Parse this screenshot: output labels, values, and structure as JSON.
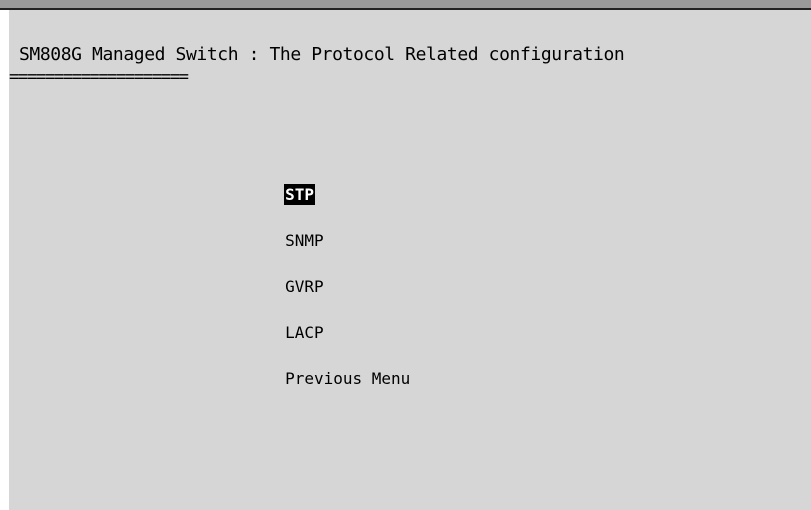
{
  "screen": {
    "title": "SM808G Managed Switch : The Protocol Related configuration",
    "divider": "===================="
  },
  "menu": {
    "selected_index": 0,
    "items": [
      {
        "label": "STP"
      },
      {
        "label": "SNMP"
      },
      {
        "label": "GVRP"
      },
      {
        "label": "LACP"
      },
      {
        "label": "Previous Menu"
      }
    ]
  },
  "colors": {
    "background": "#d6d6d6",
    "text": "#000000",
    "highlight_bg": "#000000",
    "highlight_text": "#ffffff"
  }
}
